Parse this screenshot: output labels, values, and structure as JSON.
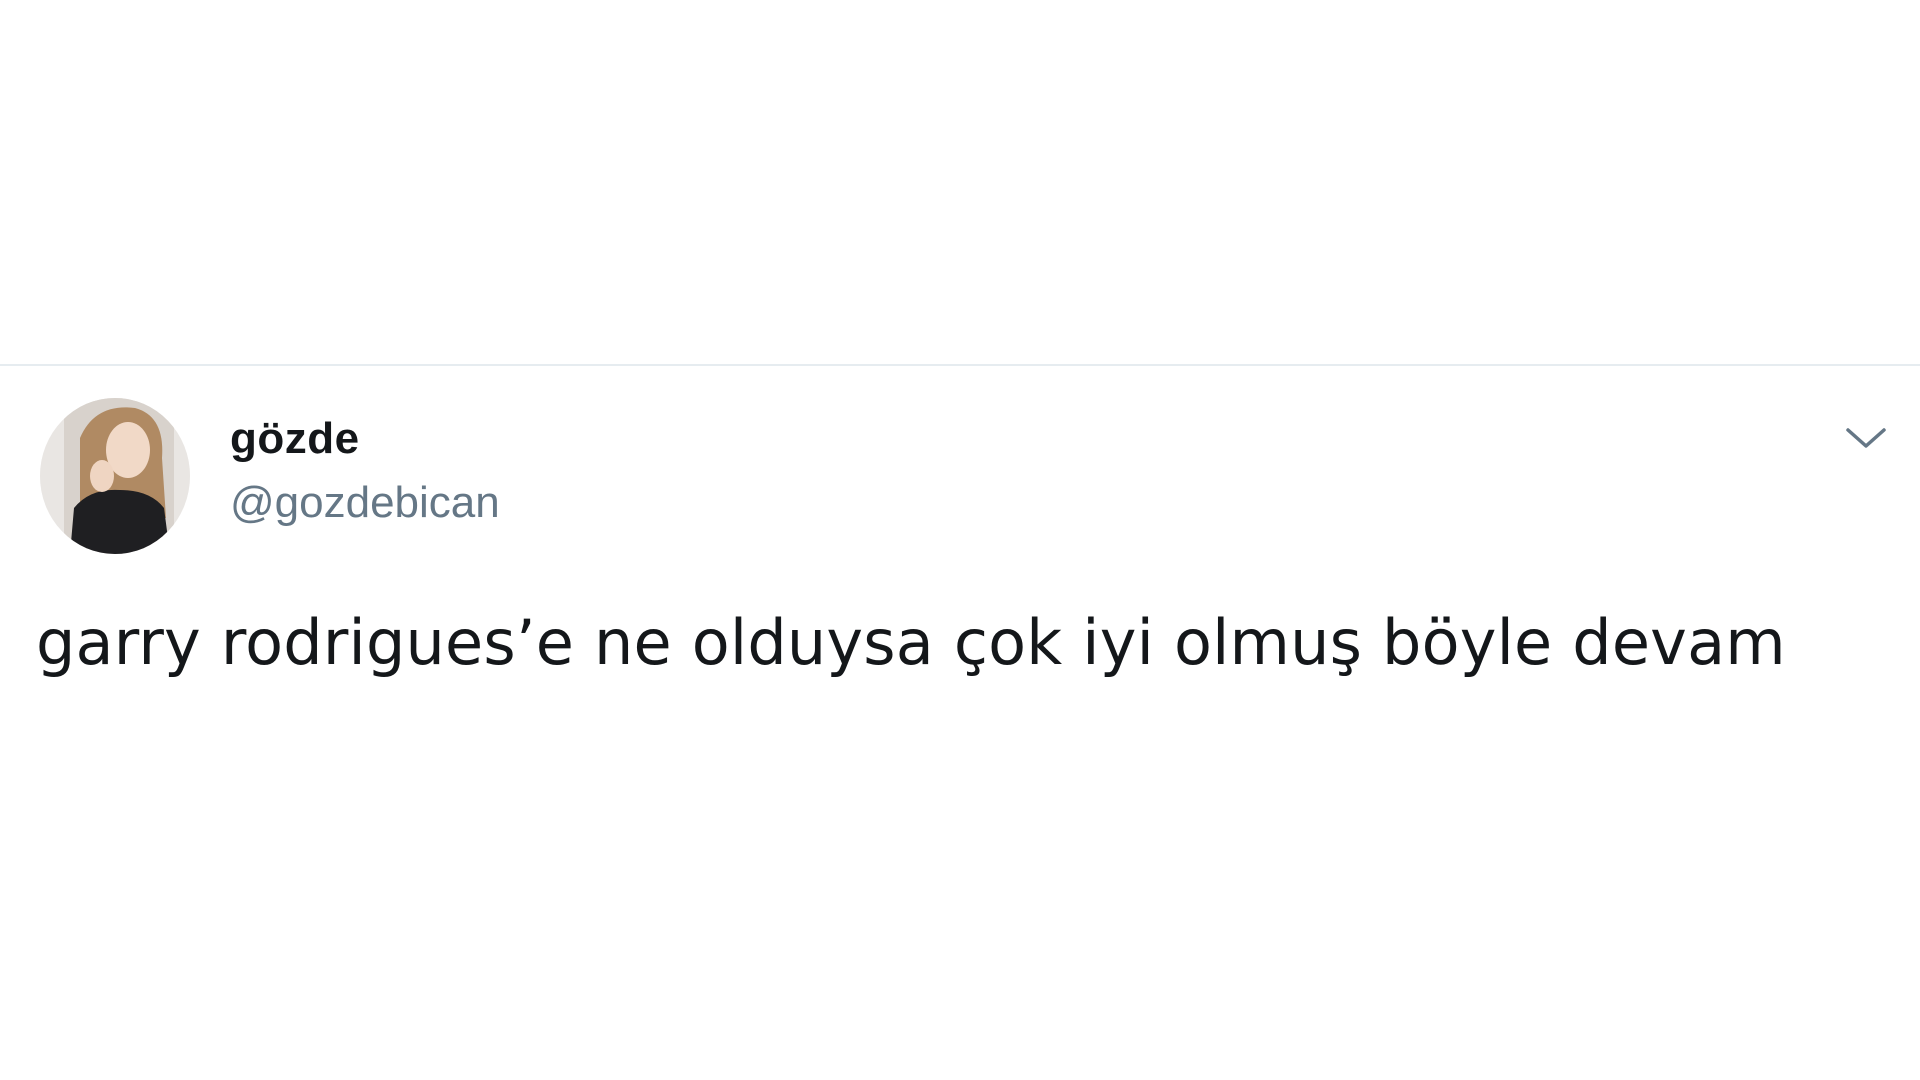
{
  "tweet": {
    "display_name": "gözde",
    "handle": "@gozdebican",
    "text": "garry rodrigues’e ne olduysa çok iyi olmuş böyle devam",
    "menu_icon": "chevron-down-icon",
    "avatar_icon": "avatar"
  },
  "colors": {
    "divider": "#e6ecf0",
    "name": "#14171a",
    "handle": "#657786",
    "caret": "#657786"
  }
}
